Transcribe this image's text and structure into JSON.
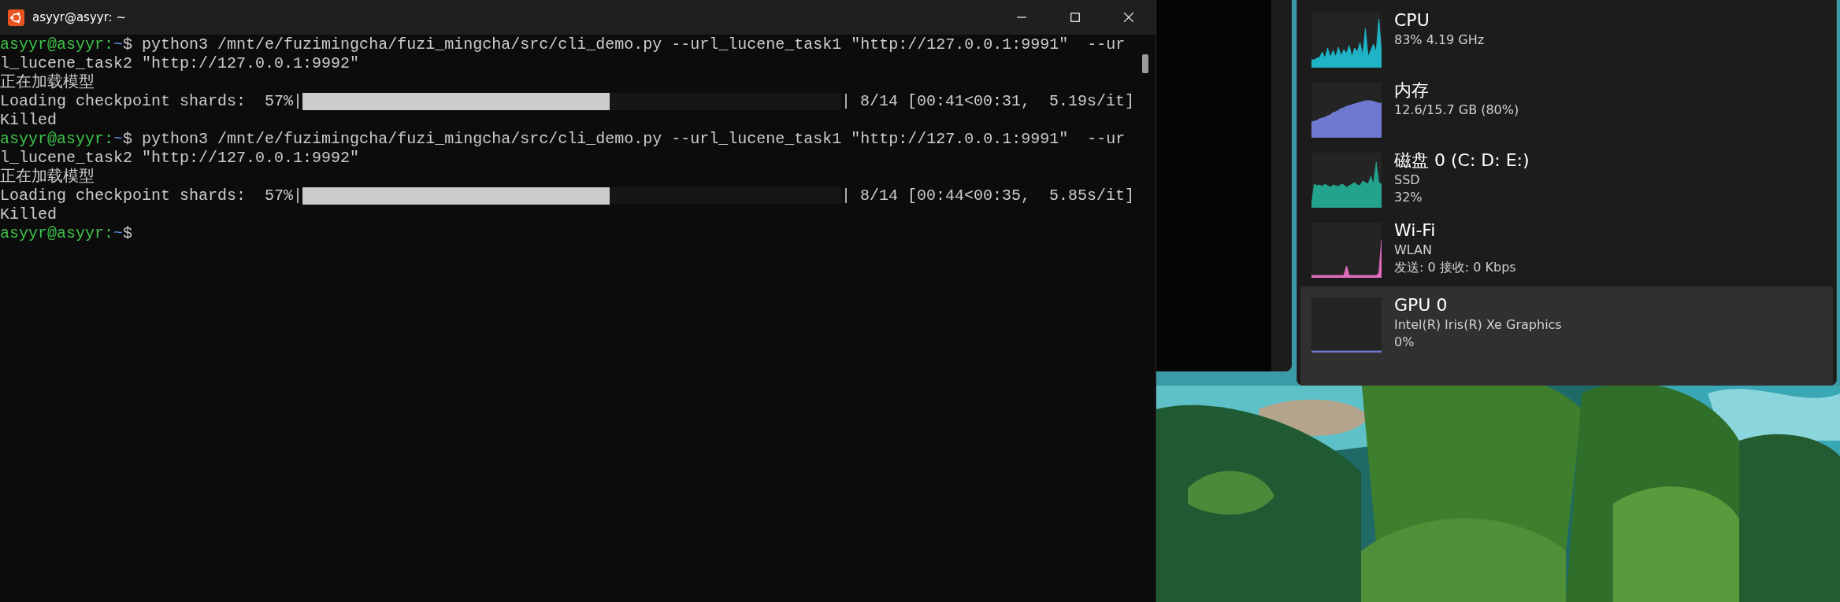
{
  "terminal": {
    "window": {
      "title": "asyyr@asyyr: ~"
    },
    "lines": [
      {
        "kind": "prompt",
        "user": "asyyr@asyyr:",
        "path": "~",
        "symbol": "$",
        "command": "python3 /mnt/e/fuzimingcha/fuzi_mingcha/src/cli_demo.py --url_lucene_task1 \"http://127.0.0.1:9991\"  --url_lucene_task2 \"http://127.0.0.1:9992\""
      },
      {
        "kind": "text",
        "text": "正在加载模型"
      },
      {
        "kind": "progress",
        "label": "Loading checkpoint shards:  57%|",
        "level": 0.57,
        "stats": "| 8/14 [00:41<00:31,  5.19s/it]"
      },
      {
        "kind": "text",
        "text": "Killed"
      },
      {
        "kind": "prompt",
        "user": "asyyr@asyyr:",
        "path": "~",
        "symbol": "$",
        "command": "python3 /mnt/e/fuzimingcha/fuzi_mingcha/src/cli_demo.py --url_lucene_task1 \"http://127.0.0.1:9991\"  --url_lucene_task2 \"http://127.0.0.1:9992\""
      },
      {
        "kind": "text",
        "text": "正在加载模型"
      },
      {
        "kind": "progress",
        "label": "Loading checkpoint shards:  57%|",
        "level": 0.57,
        "stats": "| 8/14 [00:44<00:35,  5.85s/it]"
      },
      {
        "kind": "text",
        "text": "Killed"
      },
      {
        "kind": "prompt",
        "user": "asyyr@asyyr:",
        "path": "~",
        "symbol": "$"
      }
    ]
  },
  "task_manager": {
    "items": [
      {
        "name": "CPU",
        "details": [
          "83%  4.19 GHz"
        ],
        "color": "#1fb3c6",
        "selected": false
      },
      {
        "name": "内存",
        "details": [
          "12.6/15.7 GB (80%)"
        ],
        "color": "#7079d0",
        "selected": false
      },
      {
        "name": "磁盘 0 (C: D: E:)",
        "details": [
          "SSD",
          "32%"
        ],
        "color": "#23a28c",
        "selected": false
      },
      {
        "name": "Wi-Fi",
        "details": [
          "WLAN",
          "发送: 0  接收: 0 Kbps"
        ],
        "color": "#e26bbf",
        "selected": false
      },
      {
        "name": "GPU 0",
        "details": [
          "Intel(R) Iris(R) Xe Graphics",
          "0%"
        ],
        "color": "#7079d0",
        "selected": true
      }
    ]
  }
}
